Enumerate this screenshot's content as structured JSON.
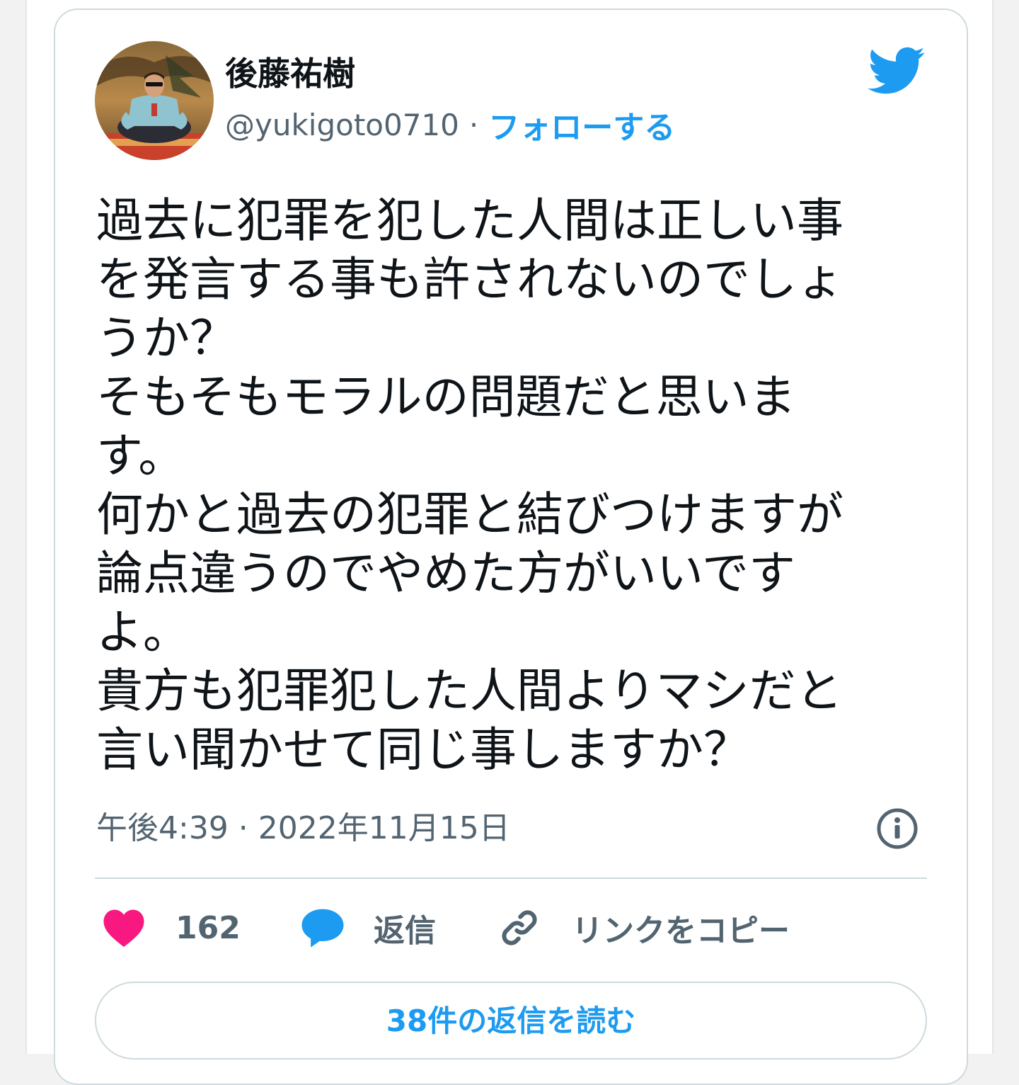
{
  "tweet": {
    "author_name": "後藤祐樹",
    "handle": "@yukigoto0710",
    "separator": "·",
    "follow_label": "フォローする",
    "text": "過去に犯罪を犯した人間は正しい事\nを発言する事も許されないのでしょ\nうか？\nそもそもモラルの問題だと思いま\nす。\n何かと過去の犯罪と結びつけますが\n論点違うのでやめた方がいいです\nよ。\n貴方も犯罪犯した人間よりマシだと\n言い聞かせて同じ事しますか？",
    "timestamp": "午後4:39 · 2022年11月15日"
  },
  "actions": {
    "like_count": "162",
    "reply_label": "返信",
    "copy_link_label": "リンクをコピー"
  },
  "read_replies_label": "38件の返信を読む",
  "icons": {
    "logo": "twitter-bird-icon",
    "info": "info-icon",
    "like": "heart-icon",
    "reply": "speech-bubble-icon",
    "copy_link": "link-icon"
  },
  "colors": {
    "accent": "#1d9bf0",
    "like": "#f91880",
    "text": "#0f1419",
    "secondary": "#536471",
    "border": "#cfd9de"
  }
}
